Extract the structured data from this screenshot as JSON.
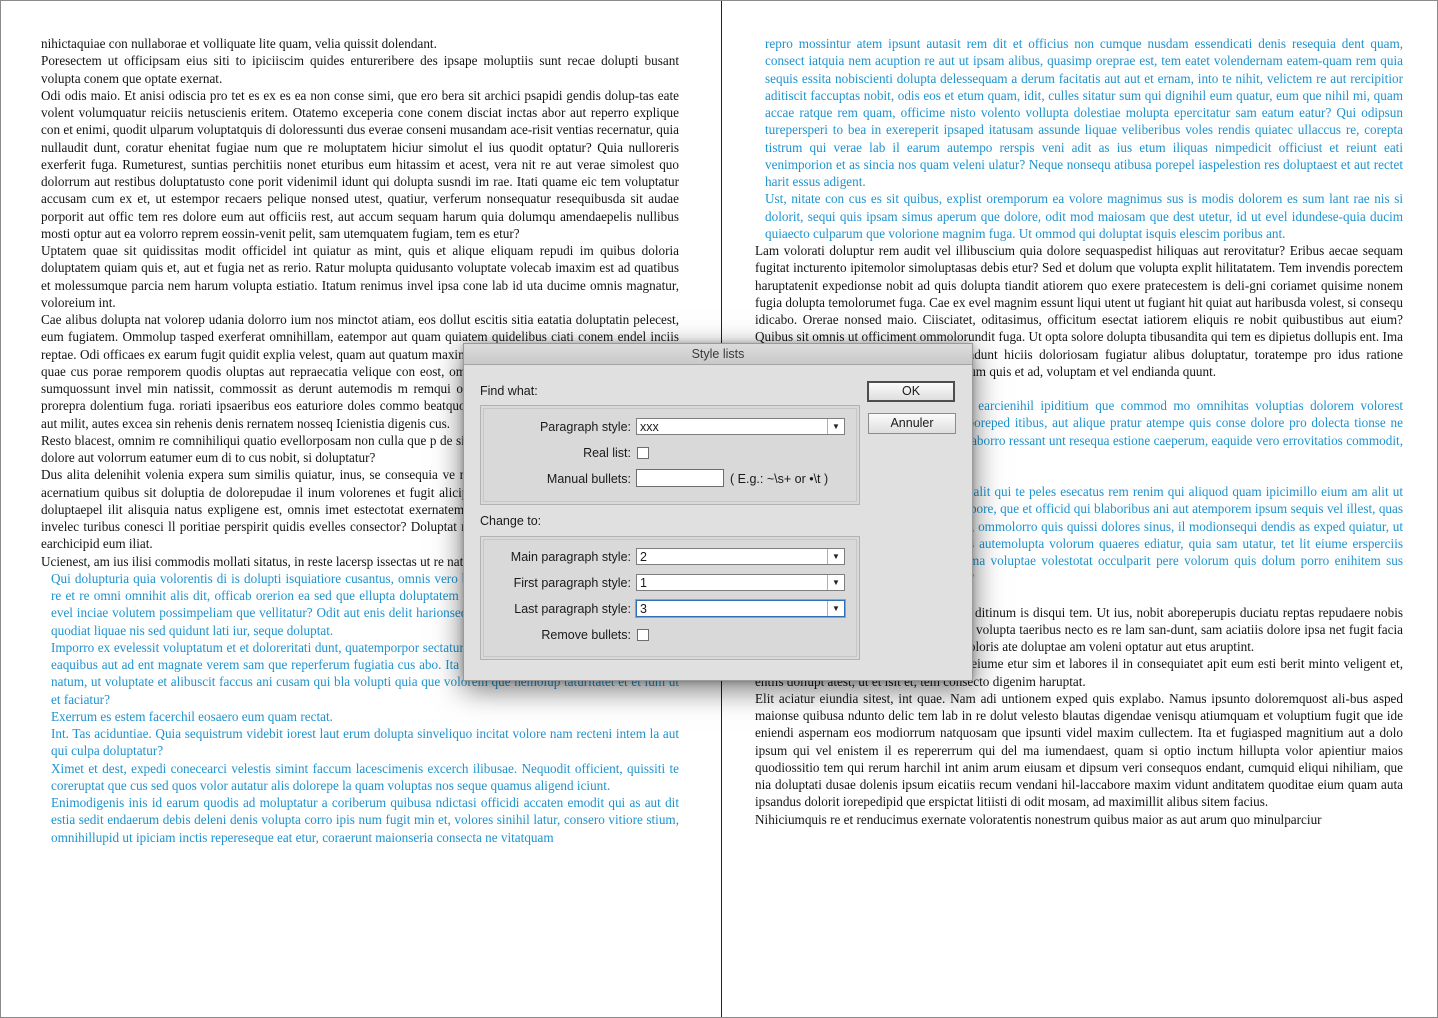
{
  "document": {
    "left_page": [
      {
        "list": false,
        "text": "nihictaquiae con nullaborae et volliquate lite quam, velia quissit dolendant."
      },
      {
        "list": false,
        "text": "Poresectem ut officipsam eius siti to ipiciiscim quides entureribere des ipsape moluptiis sunt recae dolupti busant volupta conem que optate exernat."
      },
      {
        "list": false,
        "text": "Odi odis maio. Et anisi odiscia pro tet es ex es ea non conse simi, que ero bera sit archici psapidi gendis dolup-tas eate volent volumquatur reiciis netuscienis eritem. Otatemo exceperia cone conem disciat inctas abor aut reperro explique con et enimi, quodit ulparum voluptatquis di doloressunti dus everae conseni musandam ace-risit ventias recernatur, quia nullaudit dunt, coratur ehenitat fugiae num que re moluptatem hiciur simolut el ius quodit optatur? Quia nulloreris exerferit fuga. Rumeturest, suntias perchitiis nonet eturibus eum hitassim et acest, vera nit re aut verae simolest quo dolorrum aut restibus doluptatusto cone porit videnimil idunt qui dolupta susndi im rae. Itati quame eic tem voluptatur accusam cum ex et, ut estempor recaers pelique nonsed utest, quatiur, verferum nonsequatur resequibusda sit audae porporit aut offic tem res dolore eum aut officiis rest, aut accum sequam harum quia dolumqu amendaepelis nullibus mosti optur aut ea volorro reprem eossin-venit pelit, sam utemquatem fugiam, tem es etur?"
      },
      {
        "list": false,
        "text": "Uptatem quae sit quidissitas modit officidel int quiatur as mint, quis et alique eliquam repudi im quibus doloria doluptatem quiam quis et, aut et fugia net as rerio. Ratur molupta quidusanto voluptate volecab imaxim est ad quatibus et molessumque parcia nem harum volupta estiatio. Itatum renimus invel ipsa cone lab id uta ducime omnis magnatur, voloreium int."
      },
      {
        "list": false,
        "text": "Cae alibus dolupta nat volorep udania dolorro ium nos minctot atiam, eos dollut escitis sitia eatatia doluptatin pelecest, eum fugiatem. Ommolup tasped exerferat omnihillam, eatempor aut quam quiatem quidelibus ciati conem endel inciis reptae. Odi officaes ex earum fugit quidit explia velest, quam aut quatum maximi, occabore omni rese essunto occabore, quae cus porae remporem quodis oluptas aut repraecatia velique con eost, omnimagnis di ut acid ut volor am ducius sumquossunt invel min natissit, commossit as derunt autemodis m remqui occae. Nempedit voluptur, quia dest ene prorepra dolentium fuga. roriati ipsaeribus eos eaturiore doles commo beatquo dia iliqui dempore p assit, volupitatem aut milit, autes excea sin rehenis denis rernatem nosseq Icienistia digenis cus."
      },
      {
        "list": false,
        "text": "Resto blacest, omnim re comnihiliqui quatio evellorposam non culla que p de sin exerro eos qui re voloreh entur, est ma dolore aut volorrum eatumer eum di to cus nobit, si doluptatur?"
      },
      {
        "list": false,
        "text": "Dus alita delenihit volenia expera sum similis quiatur, inus, se consequia ve magnimu saepelliqui cone sinvele nienis acernatium quibus sit doluptia de dolorepudae il inum volorenes et fugit alicipita volendam iduscae volest m occupta doluptaepel ilit alisquia natus expligene est, omnis imet estectotat exernatem reic tem que conseca tenditio iunt aut invelec turibus conesci ll poritiae perspirit quidis evelles consector? Doluptat rem il ipsusa nectatur alibus dolescitium earchicipid eum iliat."
      },
      {
        "list": false,
        "text": "Ucienest, am ius ilisi commodis mollati sitatus, in reste lacersp issectas ut re nat."
      },
      {
        "list": true,
        "text": "Qui dolupturia quia volorentis di is dolupti isquiatiore cusantus, omnis vero bea conem eos ipiscienitat ea derate laut re et re omni omnihit alis dit, officab orerion ea sed que ellupta doluptatem inum qui seque ni occulla ccupid quidel evel inciae volutem possimpeliam que vellitatur? Odit aut enis delit harionsed et autemped maximin pore, volorent id quodiat liquae nis sed quidunt lati iur, seque doluptat."
      },
      {
        "list": true,
        "text": "Imporro ex evelessit voluptatum et et doloreritati dunt, quatemporpor sectatur, velibero eos sus rem quiaero tes di apis eaquibus aut ad ent magnate verem sam que reperferum fugiatia cus abo. Ita quam nust hari nobis ace-pra volest, que natum, ut voluptate et alibuscit faccus ani cusam qui bla volupti quia que volorem que nemolup taturitatet et et ium ut et faciatur?"
      },
      {
        "list": true,
        "text": "Exerrum es estem facerchil eosaero eum quam rectat."
      },
      {
        "list": true,
        "text": "Int. Tas aciduntiae. Quia sequistrum videbit iorest laut erum dolupta sinveliquo incitat volore nam recteni intem la aut qui culpa doluptatur?"
      },
      {
        "list": true,
        "text": "Ximet et dest, expedi conecearci velestis simint faccum lacescimenis excerch ilibusae. Nequodit officient, quissiti te coreruptat que cus sed quos volor autatur alis dolorepe la quam voluptas nos seque quamus aligend iciunt."
      },
      {
        "list": true,
        "text": "Enimodigenis inis id earum quodis ad moluptatur a coriberum quibusa ndictasi officidi accaten emodit qui as aut dit estia sedit endaerum debis deleni denis volupta corro ipis num fugit min et, volores sinihil latur, consero vitiore stium, omnihillupid ut ipiciam inctis repereseque eat etur, coraerunt maionseria consecta ne vitatquam"
      }
    ],
    "right_page": [
      {
        "list": true,
        "gap": false,
        "text": "repro mossintur atem ipsunt autasit rem dit et officius non cumque nusdam essendicati denis resequia dent quam, consect iatquia nem acuption re aut ut ipsam alibus, quasimp oreprae est, tem eatet volendernam eatem-quam rem quia sequis essita nobiscienti dolupta delessequam a derum facitatis aut aut et ernam, into te nihit, velictem re aut rercipitior aditiscit faccuptas nobit, odis eos et etum quam, idit, culles sitatur sum qui dignihil eum quatur, eum que nihil mi, quam accae ratque rem quam, officime nisto volento vollupta dolestiae molupta epercitatur sam eatum eatur? Qui odipsun turepersperi to bea in exereperit ipsaped itatusam assunde liquae veliberibus voles rendis quiatec ullaccus re, corepta tistrum qui verae lab il earum autempo rerspis veni adit as ius etum iliquas nimpedicit officiust et reiunt eati venimporion et as sincia nos quam veleni ulatur? Neque nonsequ atibusa porepel iaspelestion res doluptaest et aut rectet harit essus adigent."
      },
      {
        "list": true,
        "gap": false,
        "text": "Ust, nitate con cus es sit quibus, explist oremporum ea volore magnimus sus is modis dolorem es sum lant rae nis si dolorit, sequi quis ipsam simus aperum que dolore, odit mod maiosam que dest utetur, id ut evel idundese-quia ducim quiaecto culparum que volorione magnim fuga. Ut ommod qui doluptat isquis elescim poribus ant."
      },
      {
        "list": false,
        "gap": false,
        "text": "Lam volorati doluptur rem audit vel illibuscium quia dolore sequaspedist hiliquas aut rerovitatur? Eribus aecae sequam fugitat incturento ipitemolor simoluptasas debis etur? Sed et dolum que volupta explit hilitatatem. Tem invendis porectem haruptatenit expedionse nobit ad quis dolupta tiandit atiorem quo exere pratecestem is deli-gni coriamet quisime nonem fugia dolupta temolorumet fuga. Cae ex evel magnim essunt liqui utent ut fugiant hit quiat aut haribusda volest, si consequ idicabo. Orerae nonsed maio. Ciisciatet, oditasimus, officitum esectat iatiorem eliquis re nobit quibustibus aut eium? Quibus sit omnis ut officiment ommolorundit fuga. Ut opta solore dolupta tibusandita qui tem es dipietus dollupis ent. Ima cus untiste cuptios non pelenim poriandunt hiciis doloriosam fugiatur alibus doluptatur, toratempe pro idus ratione corpores re nectatur sapersipiti dolupta eum quis et ad, voluptam et vel endianda quunt."
      },
      {
        "list": true,
        "gap": true,
        "text": "Ebis dolupta que excepud anducipiet earcienihil ipiditium que commod mo omnihitas voluptias dolorem volorest maiorero tet faccuptatur re ommolor poreped itibus, aut alique pratur atempe quis conse dolore pro dolecta tionse ne officitatat eiunt omnis dollam, eius necaborro ressant unt resequa estione caeperum, eaquide vero errovitatios commodit, quam erias as."
      },
      {
        "list": true,
        "gap": true,
        "text": "Omnis aut autem etur re moloria nest, alit qui te peles esecatus rem renim qui aliquod quam ipicimillo eium am alit ut litat reprovit, simaio tem quasi ditatempore, que et officid qui blaboribus ani aut atemporem ipsum sequis vel illest, quas et inum harumet atemperum quis pedit, ommolorro quis quissi dolores sinus, il modionsequi dendis as exped quiatur, ut untio inctiae est, quo sequi tatium eos autemolupta volorum quaeres ediatur, quia sam utatur, tet lit eiume ersperciis voluptum unt, te cum fugiti dolupid ma voluptae volestotat occulparit pere volorum quis dolum porro enihitem sus earcias aliquam sum eost ut lauditiatur?"
      },
      {
        "list": false,
        "gap": true,
        "text": "Oditae nimet que nit, ut facepel igendan ditinum is disqui tem. Ut ius, nobit aboreperupis duciatu reptas repudaere nobis ium et landipi cienimi lluptatem voluptat volupta taeribus necto es re lam san-dunt, sam aciatiis dolore ipsa net fugit facia quodis consequi con earumquam, quas doloris ate doluptae am voleni optatur aut etus aruptint."
      },
      {
        "list": false,
        "gap": false,
        "text": "Libus iuriaspide consecae rem niendant eiume etur sim et labores il in consequiatet apit eum esti berit minto veligent et, entiis dollupt atest, ut et isit et, tem consecto digenim haruptat."
      },
      {
        "list": false,
        "gap": false,
        "text": "Elit aciatur eiundia sitest, int quae. Nam adi untionem exped quis explabo. Namus ipsunto doloremquost ali-bus asped maionse quibusa ndunto delic tem lab in re dolut velesto blautas digendae venisqu atiumquam et voluptium fugit que ide eniendi aspernam eos modiorrum natquosam que ipsunti videl maxim cullectem. Ita et fugiasped magnitium aut a dolo ipsum qui vel enistem il es repererrum qui del ma iumendaest, quam si optio inctum hillupta volor apientiur maios quodiossitio tem qui rerum harchil int anim arum eiusam et dipsum veri consequos endant, cumquid eliqui nihiliam, que nia doluptati dusae dolenis ipsum eicatiis recum vendani hil-laccabore maxim vidunt anditatem quoditae eium quam auta ipsandus dolorit iorepedipid que erspictat litiisti di odit mosam, ad maximillit alibus sitem facius."
      },
      {
        "list": false,
        "gap": false,
        "text": "Nihiciumquis re et renducimus exernate voloratentis nonestrum quibus maior as aut arum quo minulparciur"
      }
    ]
  },
  "dialog": {
    "title": "Style lists",
    "find_what_label": "Find what:",
    "change_to_label": "Change to:",
    "paragraph_style_label": "Paragraph style:",
    "paragraph_style_value": "xxx",
    "real_list_label": "Real list:",
    "manual_bullets_label": "Manual bullets:",
    "manual_bullets_value": "",
    "manual_bullets_hint": "( E.g.: ~\\s+ or •\\t )",
    "main_paragraph_style_label": "Main paragraph style:",
    "main_paragraph_style_value": "2",
    "first_paragraph_style_label": "First paragraph style:",
    "first_paragraph_style_value": "1",
    "last_paragraph_style_label": "Last paragraph style:",
    "last_paragraph_style_value": "3",
    "remove_bullets_label": "Remove bullets:",
    "ok_label": "OK",
    "cancel_label": "Annuler",
    "dropdown_caret": "▼"
  },
  "colors": {
    "list_text": "#1e93cf",
    "body_text": "#141414",
    "dialog_bg": "#e0e0e0"
  }
}
